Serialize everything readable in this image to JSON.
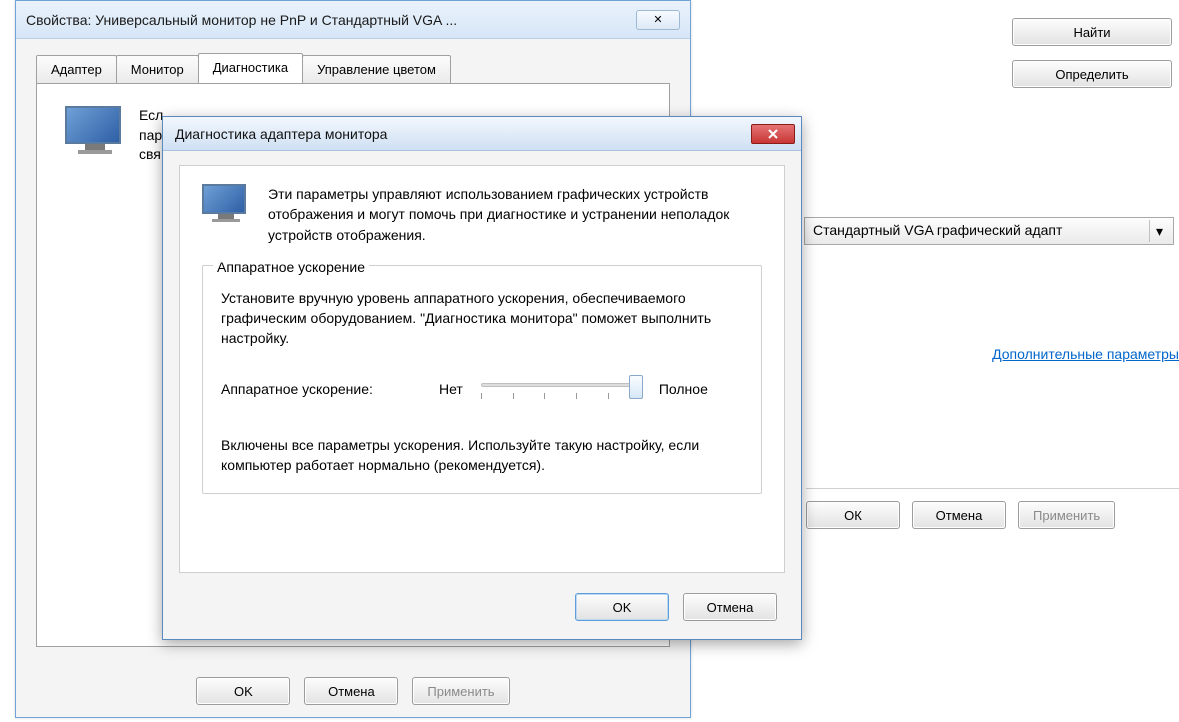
{
  "bg": {
    "find_btn": "Найти",
    "detect_btn": "Определить",
    "adapter_select": "Стандартный VGA графический адапт",
    "advanced_link": "Дополнительные параметры",
    "ok": "ОК",
    "cancel": "Отмена",
    "apply": "Применить"
  },
  "props": {
    "title": "Свойства: Универсальный монитор не PnP и Стандартный VGA ...",
    "tabs": {
      "adapter": "Адаптер",
      "monitor": "Монитор",
      "diagnostics": "Диагностика",
      "color_mgmt": "Управление цветом"
    },
    "body_line1": "Есл",
    "body_line2": "пар",
    "body_line3": "свя",
    "ok": "OK",
    "cancel": "Отмена",
    "apply": "Применить"
  },
  "diag": {
    "title": "Диагностика адаптера монитора",
    "intro": "Эти параметры управляют использованием графических устройств отображения и могут помочь при диагностике и устранении неполадок устройств отображения.",
    "group_title": "Аппаратное ускорение",
    "desc": "Установите вручную уровень аппаратного ускорения, обеспечиваемого графическим оборудованием. \"Диагностика монитора\" поможет выполнить настройку.",
    "slider_label": "Аппаратное ускорение:",
    "slider_min": "Нет",
    "slider_max": "Полное",
    "status": "Включены все параметры ускорения. Используйте такую настройку, если компьютер работает нормально (рекомендуется).",
    "ok": "OK",
    "cancel": "Отмена"
  }
}
